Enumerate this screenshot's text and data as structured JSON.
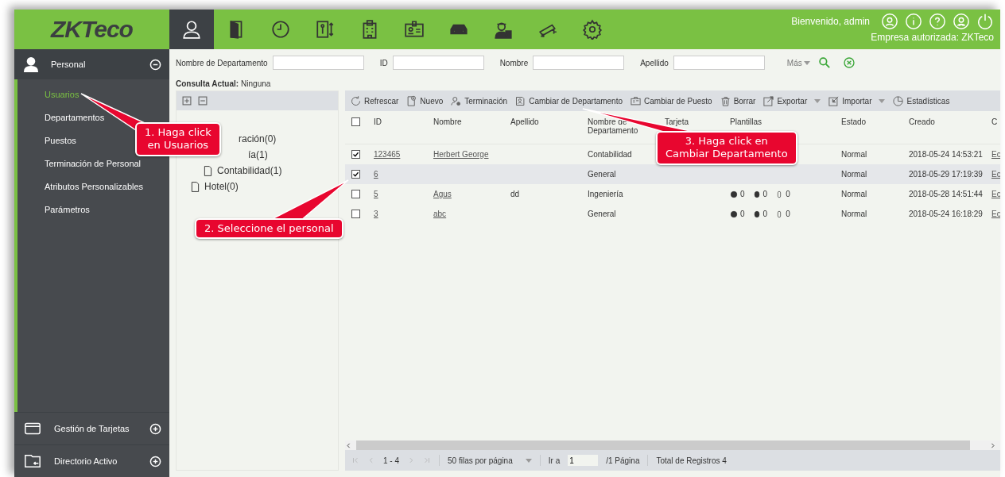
{
  "header": {
    "logo": "ZKTeco",
    "nav": [
      {
        "selected": true
      },
      {
        "selected": false
      },
      {
        "selected": false
      },
      {
        "selected": false
      },
      {
        "selected": false
      },
      {
        "selected": false
      },
      {
        "selected": false
      },
      {
        "selected": false
      },
      {
        "selected": false
      },
      {
        "selected": false
      }
    ],
    "welcome": "Bienvenido, admin",
    "company": "Empresa autorizada: ZKTeco"
  },
  "sidebar": {
    "section": {
      "label": "Personal",
      "expanded": true
    },
    "items": [
      {
        "label": "Usuarios",
        "selected": true
      },
      {
        "label": "Departamentos",
        "selected": false
      },
      {
        "label": "Puestos",
        "selected": false
      },
      {
        "label": "Terminación de Personal",
        "selected": false
      },
      {
        "label": "Atributos Personalizables",
        "selected": false
      },
      {
        "label": "Parámetros",
        "selected": false
      }
    ],
    "bottom": [
      {
        "label": "Gestión de Tarjetas",
        "expanded": false
      },
      {
        "label": "Directorio Activo",
        "expanded": false
      }
    ]
  },
  "search": {
    "fields": [
      {
        "label": "Nombre de Departamento"
      },
      {
        "label": "ID"
      },
      {
        "label": "Nombre"
      },
      {
        "label": "Apellido"
      }
    ],
    "more": "Más",
    "query_label": "Consulta Actual:",
    "query_value": "Ninguna"
  },
  "tree": {
    "items": [
      {
        "label": "ración(0)"
      },
      {
        "label": "ía(1)",
        "children": [
          {
            "label": "Contabilidad(1)"
          }
        ]
      },
      {
        "label": "Hotel(0)"
      }
    ]
  },
  "toolbar": [
    {
      "label": "Refrescar",
      "dropdown": false
    },
    {
      "label": "Nuevo",
      "dropdown": false
    },
    {
      "label": "Terminación",
      "dropdown": false
    },
    {
      "label": "Cambiar de Departamento",
      "dropdown": false
    },
    {
      "label": "Cambiar de Puesto",
      "dropdown": false
    },
    {
      "label": "Borrar",
      "dropdown": false
    },
    {
      "label": "Exportar",
      "dropdown": true
    },
    {
      "label": "Importar",
      "dropdown": true
    },
    {
      "label": "Estadísticas",
      "dropdown": false
    }
  ],
  "table": {
    "all_checked": false,
    "columns": [
      "ID",
      "Nombre",
      "Apellido",
      "Nombre de Departamento",
      "Tarjeta",
      "Plantillas",
      "Estado",
      "Creado",
      "C"
    ],
    "rows": [
      {
        "checked": true,
        "highlighted": false,
        "id": "123465",
        "nombre": "Herbert George",
        "apellido": "",
        "departamento": "Contabilidad",
        "plantillas": [],
        "estado": "Normal",
        "creado": "2018-05-24 14:53:21",
        "column_9": "Ec"
      },
      {
        "checked": true,
        "highlighted": true,
        "id": "6",
        "nombre": "",
        "apellido": "",
        "departamento": "General",
        "plantillas": [],
        "estado": "Normal",
        "creado": "2018-05-29 17:19:39",
        "column_9": "Ec"
      },
      {
        "checked": false,
        "highlighted": false,
        "id": "5",
        "nombre": "Agus",
        "apellido": "dd",
        "departamento": "Ingeniería",
        "plantillas": [
          "0",
          "0",
          "0"
        ],
        "estado": "Normal",
        "creado": "2018-05-28 14:51:44",
        "column_9": "Ec"
      },
      {
        "checked": false,
        "highlighted": false,
        "id": "3",
        "nombre": "abc",
        "apellido": "",
        "departamento": "General",
        "plantillas": [
          "0",
          "0",
          "0"
        ],
        "estado": "Normal",
        "creado": "2018-05-24 16:18:29",
        "column_9": "Ec"
      }
    ]
  },
  "pagination": {
    "range": "1 - 4",
    "per_page": "50 filas por página",
    "goto_label": "Ir a",
    "goto_value": "1",
    "pages": "/1 Página",
    "total": "Total de Registros 4"
  },
  "callouts": [
    "1. Haga click\nen Usuarios",
    "2. Seleccione el personal",
    "3. Haga click en\nCambiar Departamento"
  ]
}
